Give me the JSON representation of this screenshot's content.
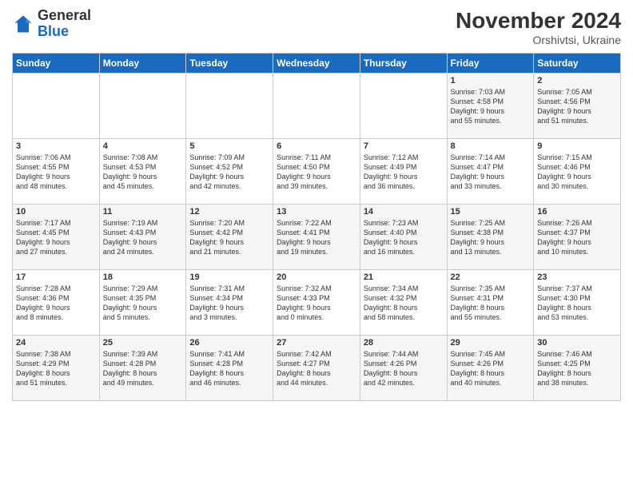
{
  "logo": {
    "general": "General",
    "blue": "Blue"
  },
  "header": {
    "month_year": "November 2024",
    "location": "Orshivtsi, Ukraine"
  },
  "days_of_week": [
    "Sunday",
    "Monday",
    "Tuesday",
    "Wednesday",
    "Thursday",
    "Friday",
    "Saturday"
  ],
  "weeks": [
    [
      {
        "day": "",
        "info": ""
      },
      {
        "day": "",
        "info": ""
      },
      {
        "day": "",
        "info": ""
      },
      {
        "day": "",
        "info": ""
      },
      {
        "day": "",
        "info": ""
      },
      {
        "day": "1",
        "info": "Sunrise: 7:03 AM\nSunset: 4:58 PM\nDaylight: 9 hours\nand 55 minutes."
      },
      {
        "day": "2",
        "info": "Sunrise: 7:05 AM\nSunset: 4:56 PM\nDaylight: 9 hours\nand 51 minutes."
      }
    ],
    [
      {
        "day": "3",
        "info": "Sunrise: 7:06 AM\nSunset: 4:55 PM\nDaylight: 9 hours\nand 48 minutes."
      },
      {
        "day": "4",
        "info": "Sunrise: 7:08 AM\nSunset: 4:53 PM\nDaylight: 9 hours\nand 45 minutes."
      },
      {
        "day": "5",
        "info": "Sunrise: 7:09 AM\nSunset: 4:52 PM\nDaylight: 9 hours\nand 42 minutes."
      },
      {
        "day": "6",
        "info": "Sunrise: 7:11 AM\nSunset: 4:50 PM\nDaylight: 9 hours\nand 39 minutes."
      },
      {
        "day": "7",
        "info": "Sunrise: 7:12 AM\nSunset: 4:49 PM\nDaylight: 9 hours\nand 36 minutes."
      },
      {
        "day": "8",
        "info": "Sunrise: 7:14 AM\nSunset: 4:47 PM\nDaylight: 9 hours\nand 33 minutes."
      },
      {
        "day": "9",
        "info": "Sunrise: 7:15 AM\nSunset: 4:46 PM\nDaylight: 9 hours\nand 30 minutes."
      }
    ],
    [
      {
        "day": "10",
        "info": "Sunrise: 7:17 AM\nSunset: 4:45 PM\nDaylight: 9 hours\nand 27 minutes."
      },
      {
        "day": "11",
        "info": "Sunrise: 7:19 AM\nSunset: 4:43 PM\nDaylight: 9 hours\nand 24 minutes."
      },
      {
        "day": "12",
        "info": "Sunrise: 7:20 AM\nSunset: 4:42 PM\nDaylight: 9 hours\nand 21 minutes."
      },
      {
        "day": "13",
        "info": "Sunrise: 7:22 AM\nSunset: 4:41 PM\nDaylight: 9 hours\nand 19 minutes."
      },
      {
        "day": "14",
        "info": "Sunrise: 7:23 AM\nSunset: 4:40 PM\nDaylight: 9 hours\nand 16 minutes."
      },
      {
        "day": "15",
        "info": "Sunrise: 7:25 AM\nSunset: 4:38 PM\nDaylight: 9 hours\nand 13 minutes."
      },
      {
        "day": "16",
        "info": "Sunrise: 7:26 AM\nSunset: 4:37 PM\nDaylight: 9 hours\nand 10 minutes."
      }
    ],
    [
      {
        "day": "17",
        "info": "Sunrise: 7:28 AM\nSunset: 4:36 PM\nDaylight: 9 hours\nand 8 minutes."
      },
      {
        "day": "18",
        "info": "Sunrise: 7:29 AM\nSunset: 4:35 PM\nDaylight: 9 hours\nand 5 minutes."
      },
      {
        "day": "19",
        "info": "Sunrise: 7:31 AM\nSunset: 4:34 PM\nDaylight: 9 hours\nand 3 minutes."
      },
      {
        "day": "20",
        "info": "Sunrise: 7:32 AM\nSunset: 4:33 PM\nDaylight: 9 hours\nand 0 minutes."
      },
      {
        "day": "21",
        "info": "Sunrise: 7:34 AM\nSunset: 4:32 PM\nDaylight: 8 hours\nand 58 minutes."
      },
      {
        "day": "22",
        "info": "Sunrise: 7:35 AM\nSunset: 4:31 PM\nDaylight: 8 hours\nand 55 minutes."
      },
      {
        "day": "23",
        "info": "Sunrise: 7:37 AM\nSunset: 4:30 PM\nDaylight: 8 hours\nand 53 minutes."
      }
    ],
    [
      {
        "day": "24",
        "info": "Sunrise: 7:38 AM\nSunset: 4:29 PM\nDaylight: 8 hours\nand 51 minutes."
      },
      {
        "day": "25",
        "info": "Sunrise: 7:39 AM\nSunset: 4:28 PM\nDaylight: 8 hours\nand 49 minutes."
      },
      {
        "day": "26",
        "info": "Sunrise: 7:41 AM\nSunset: 4:28 PM\nDaylight: 8 hours\nand 46 minutes."
      },
      {
        "day": "27",
        "info": "Sunrise: 7:42 AM\nSunset: 4:27 PM\nDaylight: 8 hours\nand 44 minutes."
      },
      {
        "day": "28",
        "info": "Sunrise: 7:44 AM\nSunset: 4:26 PM\nDaylight: 8 hours\nand 42 minutes."
      },
      {
        "day": "29",
        "info": "Sunrise: 7:45 AM\nSunset: 4:26 PM\nDaylight: 8 hours\nand 40 minutes."
      },
      {
        "day": "30",
        "info": "Sunrise: 7:46 AM\nSunset: 4:25 PM\nDaylight: 8 hours\nand 38 minutes."
      }
    ]
  ]
}
